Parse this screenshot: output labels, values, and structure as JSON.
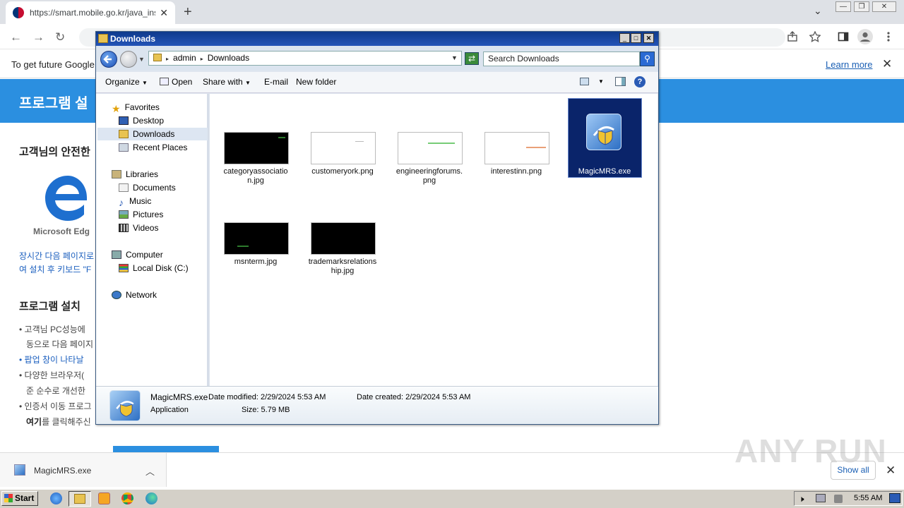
{
  "browser": {
    "tab_title": "https://smart.mobile.go.kr/java_inst",
    "tab_close": "✕",
    "new_tab": "+",
    "back": "←",
    "forward": "→",
    "reload": "↻",
    "minimize": "—",
    "restore": "❐",
    "close": "✕",
    "chevron": "⌄"
  },
  "infobar": {
    "text": "To get future Google",
    "learn_more": "Learn more",
    "close": "✕"
  },
  "page": {
    "banner": "프로그램 설",
    "section1_heading": "고객님의 안전한",
    "edge_label": "Microsoft Edg",
    "note_line1": "장시간 다음 페이지로",
    "note_line2": "여 설치 후 키보드 \"F",
    "section2_heading": "프로그램 설치 ",
    "bullet1_line1": "• 고객님 PC성능에",
    "bullet1_line2": "동으로 다음 페이지",
    "bullet2": "• 팝업 창이 나타날",
    "bullet3_line1": "• 다양한 브라우저(",
    "bullet3_line2": "준 순수로 개선한",
    "bullet4_line1": "• 인증서 이동 프로그",
    "bullet4_line2_bold": "여기",
    "bullet4_line2_rest": "를 클릭해주신"
  },
  "explorer": {
    "title": "Downloads",
    "breadcrumb": [
      "admin",
      "Downloads"
    ],
    "search_placeholder": "Search Downloads",
    "toolbar": {
      "organize": "Organize",
      "open": "Open",
      "share_with": "Share with",
      "email": "E-mail",
      "new_folder": "New folder"
    },
    "nav": {
      "favorites": "Favorites",
      "desktop": "Desktop",
      "downloads": "Downloads",
      "recent_places": "Recent Places",
      "libraries": "Libraries",
      "documents": "Documents",
      "music": "Music",
      "pictures": "Pictures",
      "videos": "Videos",
      "computer": "Computer",
      "local_disk": "Local Disk (C:)",
      "network": "Network"
    },
    "files": [
      {
        "name_l1": "categoryassociatio",
        "name_l2": "n.jpg"
      },
      {
        "name_l1": "customeryork.png",
        "name_l2": ""
      },
      {
        "name_l1": "engineeringforums.",
        "name_l2": "png"
      },
      {
        "name_l1": "interestinn.png",
        "name_l2": ""
      },
      {
        "name_l1": "MagicMRS.exe",
        "name_l2": ""
      },
      {
        "name_l1": "msnterm.jpg",
        "name_l2": ""
      },
      {
        "name_l1": "trademarksrelations",
        "name_l2": "hip.jpg"
      }
    ],
    "status": {
      "name": "MagicMRS.exe",
      "type": "Application",
      "date_modified_label": "Date modified:",
      "date_modified": "2/29/2024 5:53 AM",
      "date_created_label": "Date created:",
      "date_created": "2/29/2024 5:53 AM",
      "size_label": "Size:",
      "size": "5.79 MB"
    }
  },
  "downloads_shelf": {
    "item": "MagicMRS.exe",
    "show_all": "Show all",
    "close": "✕"
  },
  "watermark": "ANY RUN",
  "taskbar": {
    "start": "Start",
    "clock": "5:55 AM"
  },
  "colors": {
    "explorer_title": "#0e3a8c",
    "selection": "#0a246a",
    "page_banner": "#2b8fe0"
  }
}
